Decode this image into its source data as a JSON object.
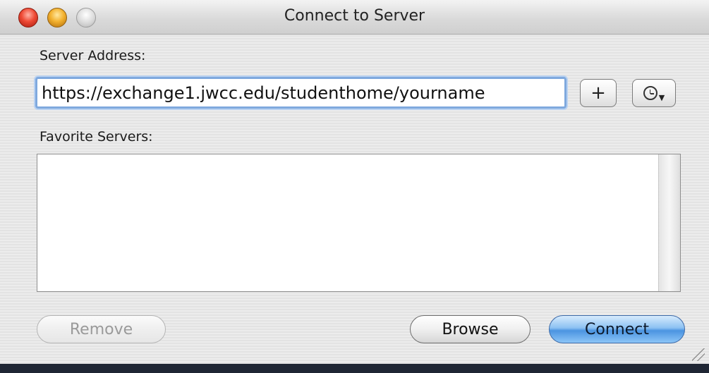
{
  "window": {
    "title": "Connect to Server"
  },
  "labels": {
    "server_address": "Server Address:",
    "favorite_servers": "Favorite Servers:"
  },
  "address_field": {
    "value": "https://exchange1.jwcc.edu/studenthome/yourname"
  },
  "buttons": {
    "add": "+",
    "remove": "Remove",
    "browse": "Browse",
    "connect": "Connect"
  },
  "favorites": [],
  "icons": {
    "add": "plus-icon",
    "recent": "clock-icon",
    "resize": "resize-grip-icon"
  },
  "colors": {
    "connect_button": "#6aaaf0",
    "focus_ring": "#7fa9de"
  }
}
